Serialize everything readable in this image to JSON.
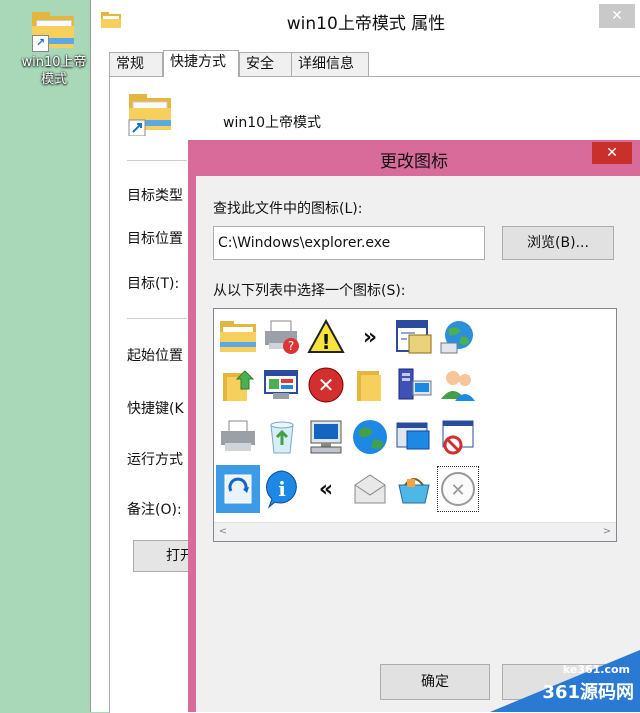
{
  "desktop": {
    "shortcut_label": "win10上帝模式"
  },
  "properties_window": {
    "title": "win10上帝模式 属性",
    "close_glyph": "✕",
    "tabs": [
      {
        "label": "常规"
      },
      {
        "label": "快捷方式"
      },
      {
        "label": "安全"
      },
      {
        "label": "详细信息"
      }
    ],
    "target_name": "win10上帝模式",
    "field_labels": {
      "target_type": "目标类型",
      "target_location": "目标位置",
      "target": "目标(T):",
      "start_in": "起始位置",
      "shortcut_key": "快捷键(K",
      "run": "运行方式",
      "comment": "备注(O):"
    },
    "open_button_label": "打开"
  },
  "change_icon_dialog": {
    "title": "更改图标",
    "close_glyph": "✕",
    "file_label": "查找此文件中的图标(L):",
    "file_path_value": "C:\\Windows\\explorer.exe",
    "browse_label": "浏览(B)...",
    "list_label": "从以下列表中选择一个图标(S):",
    "ok_label": "确定",
    "scroll_left": "<",
    "scroll_right": ">"
  },
  "icons": [
    {
      "name": "folder-icon"
    },
    {
      "name": "printer-help-icon"
    },
    {
      "name": "warning-icon",
      "glyph": "!"
    },
    {
      "name": "double-chevron-right-icon",
      "glyph": "»"
    },
    {
      "name": "document-window-icon"
    },
    {
      "name": "network-globe-icon"
    },
    {
      "name": "folder-upload-icon"
    },
    {
      "name": "control-panel-icon"
    },
    {
      "name": "error-icon",
      "glyph": "✕"
    },
    {
      "name": "folder-yellow-icon"
    },
    {
      "name": "server-computer-icon"
    },
    {
      "name": "users-icon"
    },
    {
      "name": "printer-icon"
    },
    {
      "name": "recycle-bin-icon"
    },
    {
      "name": "computer-icon"
    },
    {
      "name": "globe-icon"
    },
    {
      "name": "monitor-window-icon"
    },
    {
      "name": "window-block-icon"
    },
    {
      "name": "refresh-doc-icon"
    },
    {
      "name": "info-icon",
      "glyph": "i"
    },
    {
      "name": "double-chevron-left-icon",
      "glyph": "«"
    },
    {
      "name": "mail-icon"
    },
    {
      "name": "basket-icon"
    },
    {
      "name": "disabled-circle-icon",
      "glyph": "✕"
    }
  ],
  "watermark": {
    "site": "ke361.com",
    "name": "361源码网"
  }
}
